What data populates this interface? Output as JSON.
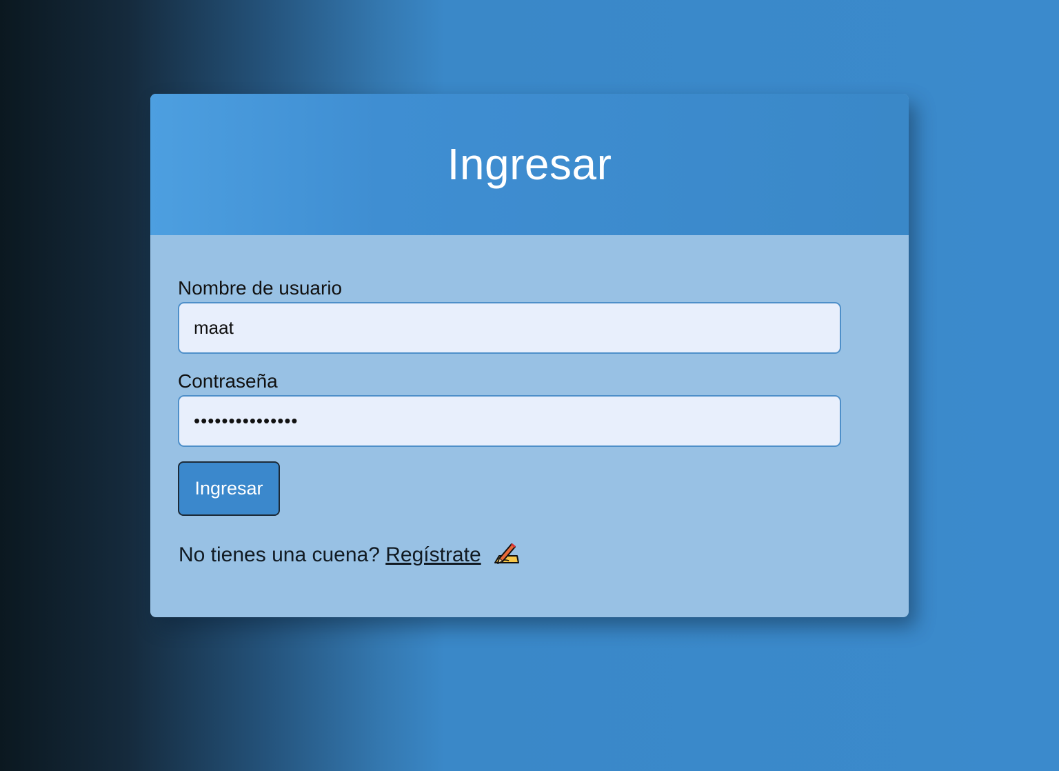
{
  "header": {
    "title": "Ingresar"
  },
  "form": {
    "username_label": "Nombre de usuario",
    "username_value": "maat",
    "password_label": "Contraseña",
    "password_value": "•••••••••••••••",
    "submit_label": "Ingresar"
  },
  "footer": {
    "prompt": "No tienes una cuena?",
    "register_link": "Regístrate",
    "register_icon": "writing-hand-icon"
  },
  "colors": {
    "accent": "#3b88cc",
    "card_body": "#98c1e4",
    "input_bg": "#e8effc"
  }
}
